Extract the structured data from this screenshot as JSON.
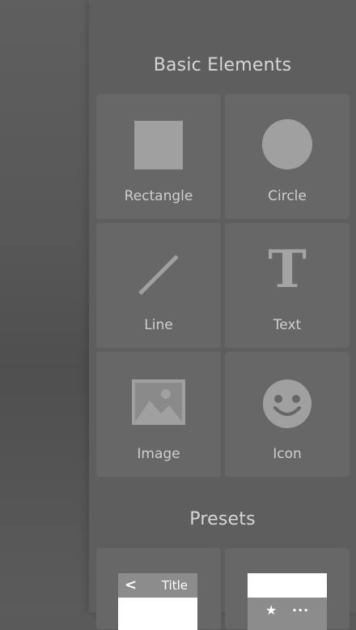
{
  "sections": {
    "basic_title": "Basic Elements",
    "presets_title": "Presets"
  },
  "basic_elements": [
    {
      "label": "Rectangle",
      "icon": "rectangle-icon"
    },
    {
      "label": "Circle",
      "icon": "circle-icon"
    },
    {
      "label": "Line",
      "icon": "line-icon"
    },
    {
      "label": "Text",
      "icon": "text-icon"
    },
    {
      "label": "Image",
      "icon": "image-icon"
    },
    {
      "label": "Icon",
      "icon": "smiley-icon"
    }
  ],
  "presets": [
    {
      "name": "navigation-bar-preset",
      "title_text": "Title",
      "back_glyph": "<"
    },
    {
      "name": "tab-bar-preset",
      "star_glyph": "★",
      "more_glyph": "..."
    }
  ],
  "colors": {
    "background": "#5a5a5a",
    "panel": "#5e5e5e",
    "tile": "#676767",
    "shape": "#a0a0a0",
    "text": "#cfcfcf"
  }
}
